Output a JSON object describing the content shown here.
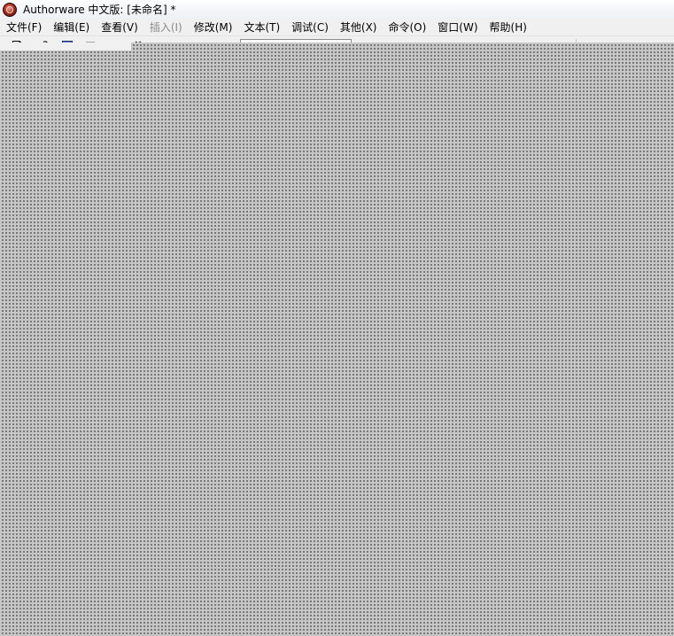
{
  "window": {
    "title": "Authorware 中文版: [未命名] *",
    "app_icon": "authorware-logo-icon"
  },
  "menubar": {
    "items": [
      {
        "label": "文件(F)",
        "enabled": true
      },
      {
        "label": "编辑(E)",
        "enabled": true
      },
      {
        "label": "查看(V)",
        "enabled": true
      },
      {
        "label": "插入(I)",
        "enabled": false
      },
      {
        "label": "修改(M)",
        "enabled": true
      },
      {
        "label": "文本(T)",
        "enabled": true
      },
      {
        "label": "调试(C)",
        "enabled": true
      },
      {
        "label": "其他(X)",
        "enabled": true
      },
      {
        "label": "命令(O)",
        "enabled": true
      },
      {
        "label": "窗口(W)",
        "enabled": true
      },
      {
        "label": "帮助(H)",
        "enabled": true
      }
    ]
  },
  "toolbar": {
    "buttons": [
      {
        "icon": "new-file-icon",
        "enabled": true
      },
      {
        "icon": "open-folder-icon",
        "enabled": true
      },
      {
        "icon": "save-all-icon",
        "enabled": true
      },
      {
        "icon": "import-icon",
        "enabled": false
      },
      {
        "icon": "undo-icon",
        "enabled": false
      },
      {
        "icon": "cut-icon",
        "enabled": true
      }
    ]
  },
  "workspace": {
    "pattern": "dotted-grid",
    "colors": {
      "background": "#c6c6c6",
      "dot": "#5e5e5e"
    }
  }
}
